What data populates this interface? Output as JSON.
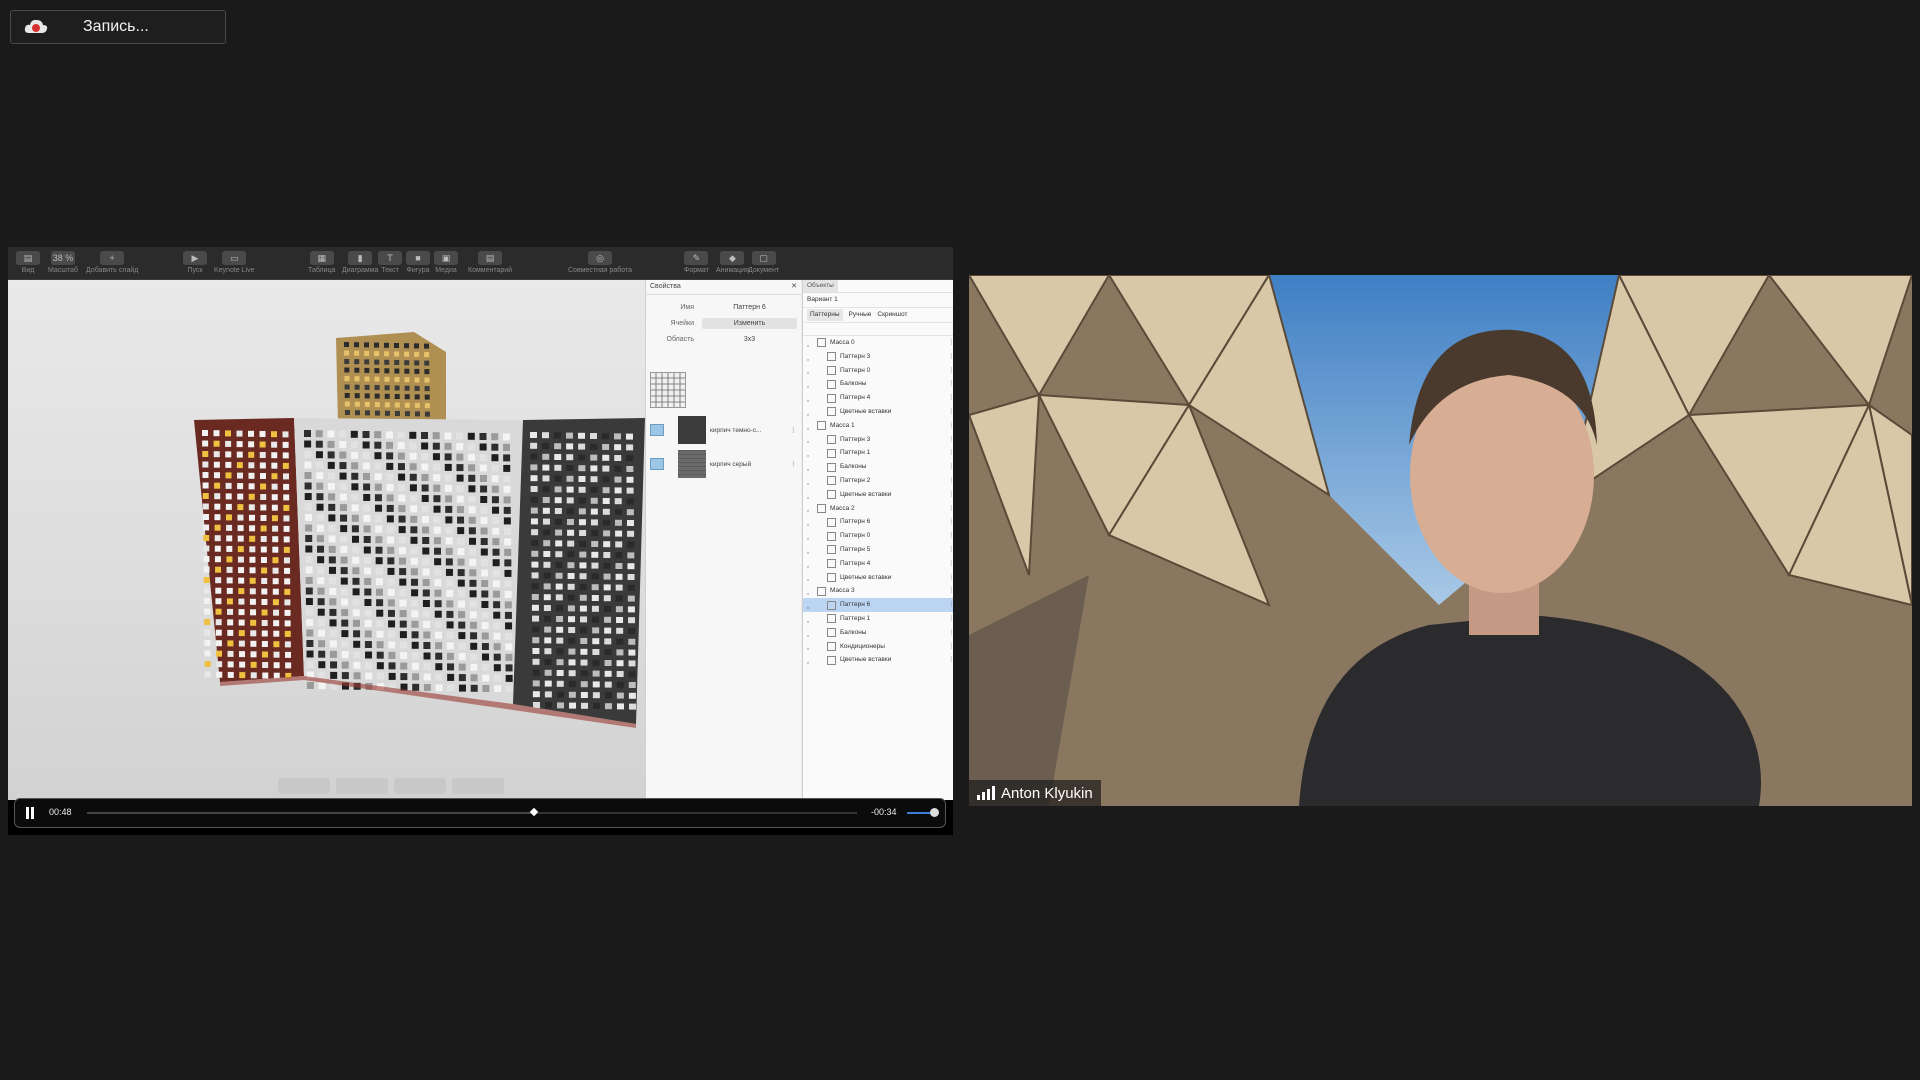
{
  "recording": {
    "label": "Запись..."
  },
  "toolbar": {
    "items": [
      {
        "cap": "Вид",
        "glyph": "▤"
      },
      {
        "cap": "Масштаб",
        "glyph": "38 %"
      },
      {
        "cap": "Добавить слайд",
        "glyph": "+"
      },
      {
        "cap": "Пуск",
        "glyph": "▶"
      },
      {
        "cap": "Keynote Live",
        "glyph": "▭"
      },
      {
        "cap": "Таблица",
        "glyph": "▦"
      },
      {
        "cap": "Диаграмма",
        "glyph": "▮"
      },
      {
        "cap": "Текст",
        "glyph": "T"
      },
      {
        "cap": "Фигура",
        "glyph": "■"
      },
      {
        "cap": "Медиа",
        "glyph": "▣"
      },
      {
        "cap": "Комментарий",
        "glyph": "▤"
      },
      {
        "cap": "Совместная работа",
        "glyph": "◎"
      },
      {
        "cap": "Формат",
        "glyph": "✎"
      },
      {
        "cap": "Анимация",
        "glyph": "◆"
      },
      {
        "cap": "Документ",
        "glyph": "▢"
      }
    ]
  },
  "properties": {
    "title": "Свойства",
    "name_label": "Имя",
    "name_value": "Паттерн 6",
    "cells_label": "Ячейки",
    "cells_button": "Изменить",
    "area_label": "Область",
    "area_value": "3x3",
    "materials": [
      "кирпич темно-с...",
      "кирпич серый"
    ]
  },
  "tree": {
    "tab": "Объекты",
    "variant": "Вариант 1",
    "subtabs": [
      "Паттерны",
      "Ручные",
      "Скриншот"
    ],
    "rows": [
      {
        "name": "Масса 0",
        "type": "group"
      },
      {
        "name": "Паттерн 3",
        "type": "child"
      },
      {
        "name": "Паттерн 0",
        "type": "child"
      },
      {
        "name": "Балконы",
        "type": "child"
      },
      {
        "name": "Паттерн 4",
        "type": "child"
      },
      {
        "name": "Цветные вставки",
        "type": "child"
      },
      {
        "name": "Масса 1",
        "type": "group"
      },
      {
        "name": "Паттерн 3",
        "type": "child"
      },
      {
        "name": "Паттерн 1",
        "type": "child"
      },
      {
        "name": "Балконы",
        "type": "child"
      },
      {
        "name": "Паттерн 2",
        "type": "child"
      },
      {
        "name": "Цветные вставки",
        "type": "child"
      },
      {
        "name": "Масса 2",
        "type": "group"
      },
      {
        "name": "Паттерн 6",
        "type": "child"
      },
      {
        "name": "Паттерн 0",
        "type": "child"
      },
      {
        "name": "Паттерн 5",
        "type": "child"
      },
      {
        "name": "Паттерн 4",
        "type": "child"
      },
      {
        "name": "Цветные вставки",
        "type": "child"
      },
      {
        "name": "Масса 3",
        "type": "group"
      },
      {
        "name": "Паттерн 6",
        "type": "child",
        "selected": true
      },
      {
        "name": "Паттерн 1",
        "type": "child"
      },
      {
        "name": "Балконы",
        "type": "child"
      },
      {
        "name": "Кондиционеры",
        "type": "child"
      },
      {
        "name": "Цветные вставки",
        "type": "child"
      }
    ]
  },
  "player": {
    "elapsed": "00:48",
    "remaining": "-00:34",
    "progress": 0.58,
    "volume": 0.8
  },
  "participant": {
    "name": "Anton Klyukin"
  },
  "colors": {
    "selection": "#bcd5f3",
    "volume": "#3c7dd9"
  }
}
